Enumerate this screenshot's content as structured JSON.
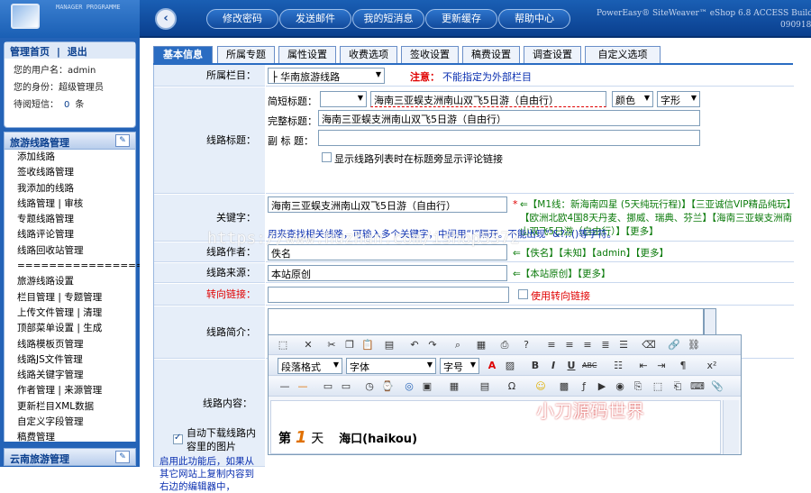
{
  "header": {
    "logo_text": "MANAGER PROGRAMME",
    "buttons": [
      "修改密码",
      "发送邮件",
      "我的短消息",
      "更新缓存",
      "帮助中心"
    ],
    "brand": "PowerEasy® SiteWeaver™ eShop 6.8 ACCESS Build",
    "build": "090918"
  },
  "sidebar": {
    "nav": {
      "home": "管理首页",
      "sep": "|",
      "logout": "退出"
    },
    "user": {
      "username_label": "您的用户名：",
      "username": "admin",
      "role_label": "您的身份：",
      "role": "超级管理员",
      "msg_label": "待阅短信：",
      "msg_count": "0",
      "msg_unit": "条"
    },
    "section_title": "旅游线路管理",
    "items": [
      "添加线路",
      "签收线路管理",
      "我添加的线路",
      "线路管理 | 审核",
      "专题线路管理",
      "线路评论管理",
      "线路回收站管理",
      "====================",
      "旅游线路设置",
      "栏目管理 | 专题管理",
      "上传文件管理 | 清理",
      "顶部菜单设置 | 生成",
      "线路模板页管理",
      "线路JS文件管理",
      "线路关键字管理",
      "作者管理 | 来源管理",
      "更新栏目XML数据",
      "自定义字段管理",
      "稿费管理"
    ],
    "section2_title": "云南旅游管理"
  },
  "tabs": [
    "基本信息",
    "所属专题",
    "属性设置",
    "收费选项",
    "签收设置",
    "稿费设置",
    "调查设置",
    "自定义选项"
  ],
  "form": {
    "column": {
      "label": "所属栏目：",
      "value": "├ 华南旅游线路",
      "note_prefix": "注意：",
      "note": "不能指定为外部栏目"
    },
    "title": {
      "label": "线路标题：",
      "short_label": "简短标题：",
      "short_value": "海南三亚蜈支洲南山双飞5日游（自由行）",
      "color": "颜色",
      "font": "字形",
      "full_label": "完整标题：",
      "full_value": "海南三亚蜈支洲南山双飞5日游（自由行）",
      "sub_label": "副 标 题：",
      "sub_value": "",
      "show_comment": "显示线路列表时在标题旁显示评论链接"
    },
    "keywords": {
      "label": "关键字：",
      "value": "海南三亚蜈支洲南山双飞5日游（自由行）",
      "star": "*",
      "hints": "⇐【M1线：新海南四星 (5天纯玩行程)】【三亚诚信VIP精品纯玩】【欧洲北欧4国8天丹麦、挪威、瑞典、芬兰】【海南三亚蜈支洲南山双飞5日游（自由行）】【更多】",
      "help": "用来查找相关线路，可输入多个关键字，中间用“|”隔开。不能出现\"'&?;:()等字符。"
    },
    "author": {
      "label": "线路作者：",
      "value": "佚名",
      "hints": "⇐【佚名】【未知】【admin】【更多】"
    },
    "source": {
      "label": "线路来源：",
      "value": "本站原创",
      "hints": "⇐【本站原创】【更多】"
    },
    "redirect": {
      "label": "转向链接：",
      "value": "",
      "checkbox": "使用转向链接"
    },
    "intro": {
      "label": "线路简介：",
      "value": ""
    },
    "content": {
      "label": "线路内容：",
      "auto_download": "自动下载线路内容里的图片",
      "auto_help": "启用此功能后，如果从其它网站上复制内容到右边的编辑器中，",
      "para_format": "段落格式",
      "font": "字体",
      "size": "字号",
      "body_day": "第",
      "body_num": "1",
      "body_tian": "天",
      "body_place": "海口(haikou)"
    }
  },
  "watermark": {
    "url": "https://www.huzhan.com/ishop5572",
    "text": "小刀源码世界"
  }
}
